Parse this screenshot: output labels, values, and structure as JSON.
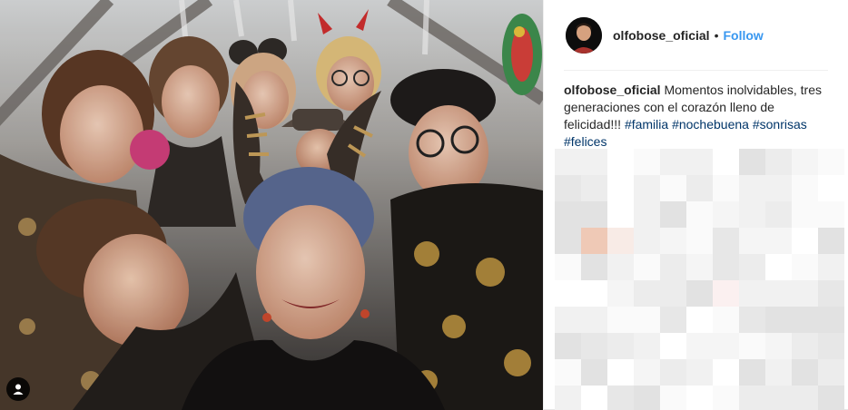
{
  "post": {
    "photo": {
      "alt": "",
      "user_tag_icon": "person-icon"
    },
    "header": {
      "username": "olfobose_oficial",
      "separator": "•",
      "follow_label": "Follow"
    },
    "caption": {
      "username": "olfobose_oficial",
      "text": "Momentos inolvidables, tres generaciones con el corazón lleno de felicidad!!!",
      "hashtags": [
        "#familia",
        "#nochebuena",
        "#sonrisas",
        "#felices"
      ]
    },
    "comments_blurred": true
  },
  "colors": {
    "follow": "#3897f0",
    "hashtag": "#003569",
    "text": "#262626",
    "divider": "#efefef"
  }
}
